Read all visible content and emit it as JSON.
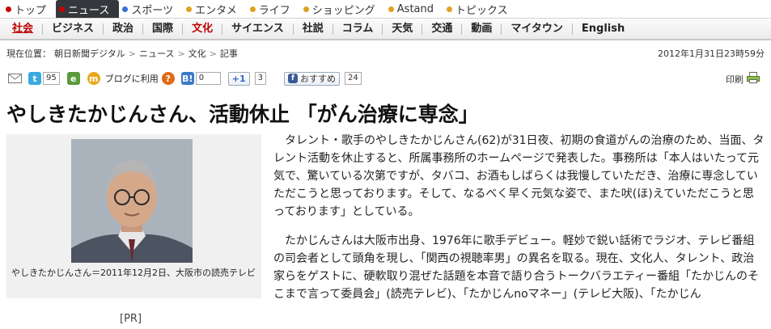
{
  "topnav": {
    "items": [
      {
        "label": "トップ",
        "color": "#cc0000",
        "active": false
      },
      {
        "label": "ニュース",
        "color": "#cc0000",
        "active": true
      },
      {
        "label": "スポーツ",
        "color": "#3a6fd8",
        "active": false
      },
      {
        "label": "エンタメ",
        "color": "#e0a020",
        "active": false
      },
      {
        "label": "ライフ",
        "color": "#e0a020",
        "active": false
      },
      {
        "label": "ショッピング",
        "color": "#e0a020",
        "active": false
      },
      {
        "label": "Astand",
        "color": "#e0a020",
        "active": false
      },
      {
        "label": "トピックス",
        "color": "#e0a020",
        "active": false
      }
    ]
  },
  "secnav": {
    "items": [
      "社会",
      "ビジネス",
      "政治",
      "国際",
      "文化",
      "サイエンス",
      "社説",
      "コラム",
      "天気",
      "交通",
      "動画",
      "マイタウン",
      "English"
    ]
  },
  "breadcrumb": {
    "prefix": "現在位置：",
    "items": [
      "朝日新聞デジタル",
      "ニュース",
      "文化",
      "記事"
    ],
    "separator": ">"
  },
  "timestamp": "2012年1月31日23時59分",
  "share": {
    "twitter_count": "95",
    "blog_label": "ブログに利用",
    "hatena_count": "0",
    "gplus_label": "+1",
    "gplus_count": "3",
    "fb_label": "おすすめ",
    "fb_count": "24"
  },
  "print_label": "印刷",
  "headline": "やしきたかじんさん、活動休止 「がん治療に専念」",
  "photo": {
    "caption": "やしきたかじんさん＝2011年12月2日、大阪市の読売テレビ"
  },
  "pr_label": "[PR]",
  "article": {
    "paragraphs": [
      "タレント・歌手のやしきたかじんさん(62)が31日夜、初期の食道がんの治療のため、当面、タレント活動を休止すると、所属事務所のホームページで発表した。事務所は「本人はいたって元気で、驚いている次第ですが、タバコ、お酒もしばらくは我慢していただき、治療に専念していただこうと思っております。そして、なるべく早く元気な姿で、また吠(ほ)えていただこうと思っております」としている。",
      "たかじんさんは大阪市出身、1976年に歌手デビュー。軽妙で鋭い話術でラジオ、テレビ番組の司会者として頭角を現し、「関西の視聴率男」の異名を取る。現在、文化人、タレント、政治家らをゲストに、硬軟取り混ぜた話題を本音で語り合うトークバラエティー番組「たかじんのそこまで言って委員会」(読売テレビ)、「たかじんnoマネー」(テレビ大阪)、「たかじん"
    ]
  },
  "colors": {
    "nav_active_bg": "#34383c",
    "section_selected": "#bb0000",
    "twitter": "#3aa9e0",
    "hatena": "#3c7ac9",
    "facebook": "#3b5998"
  }
}
